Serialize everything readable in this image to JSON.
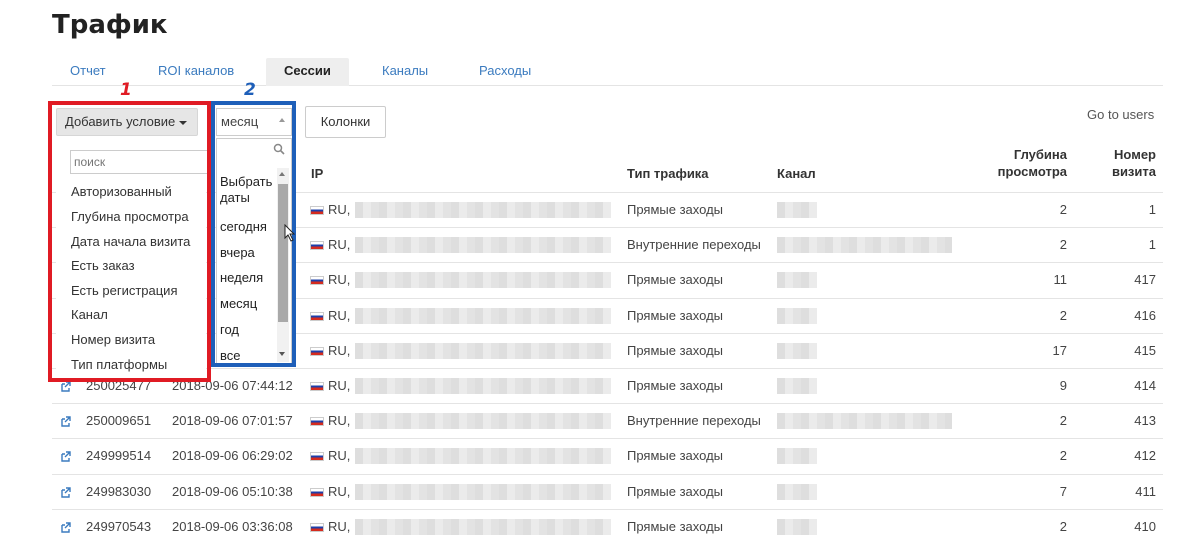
{
  "page": {
    "title": "Трафик"
  },
  "tabs": [
    {
      "label": "Отчет",
      "active": false
    },
    {
      "label": "ROI каналов",
      "active": false
    },
    {
      "label": "Сессии",
      "active": true
    },
    {
      "label": "Каналы",
      "active": false
    },
    {
      "label": "Расходы",
      "active": false
    }
  ],
  "toolbar": {
    "add_condition_label": "Добавить условие",
    "period_value": "месяц",
    "columns_label": "Колонки",
    "go_users_label": "Go to users"
  },
  "condition_dropdown": {
    "search_placeholder": "поиск",
    "items": [
      "Авторизованный",
      "Глубина просмотра",
      "Дата начала визита",
      "Есть заказ",
      "Есть регистрация",
      "Канал",
      "Номер визита",
      "Тип платформы"
    ]
  },
  "period_dropdown": {
    "options": [
      "Выбрать даты",
      "сегодня",
      "вчера",
      "неделя",
      "месяц",
      "год",
      "все"
    ]
  },
  "annotations": {
    "label1": "1",
    "label2": "2",
    "color1": "#e01b24",
    "color2": "#1e5fb9"
  },
  "table": {
    "headers": {
      "ip": "IP",
      "traffic_type": "Тип трафика",
      "channel": "Канал",
      "depth": "Глубина просмотра",
      "visit_number": "Номер визита"
    },
    "rows": [
      {
        "id": "",
        "datetime": "",
        "ip": "RU, I",
        "traffic_type": "Прямые заходы",
        "depth": "2",
        "visit_number": "1"
      },
      {
        "id": "",
        "datetime": "",
        "ip": "RU, I",
        "traffic_type": "Внутренние переходы",
        "depth": "2",
        "visit_number": "1"
      },
      {
        "id": "",
        "datetime": "",
        "ip": "RU, I",
        "traffic_type": "Прямые заходы",
        "depth": "11",
        "visit_number": "417"
      },
      {
        "id": "",
        "datetime": "",
        "ip": "RU, I",
        "traffic_type": "Прямые заходы",
        "depth": "2",
        "visit_number": "416"
      },
      {
        "id": "",
        "datetime": "",
        "ip": "RU, I",
        "traffic_type": "Прямые заходы",
        "depth": "17",
        "visit_number": "415"
      },
      {
        "id": "250025477",
        "datetime": "2018-09-06 07:44:12",
        "ip": "RU, I",
        "traffic_type": "Прямые заходы",
        "depth": "9",
        "visit_number": "414"
      },
      {
        "id": "250009651",
        "datetime": "2018-09-06 07:01:57",
        "ip": "RU, I",
        "traffic_type": "Внутренние переходы",
        "depth": "2",
        "visit_number": "413"
      },
      {
        "id": "249999514",
        "datetime": "2018-09-06 06:29:02",
        "ip": "RU, I",
        "traffic_type": "Прямые заходы",
        "depth": "2",
        "visit_number": "412"
      },
      {
        "id": "249983030",
        "datetime": "2018-09-06 05:10:38",
        "ip": "RU, I",
        "traffic_type": "Прямые заходы",
        "depth": "7",
        "visit_number": "411"
      },
      {
        "id": "249970543",
        "datetime": "2018-09-06 03:36:08",
        "ip": "RU, I",
        "traffic_type": "Прямые заходы",
        "depth": "2",
        "visit_number": "410"
      }
    ]
  }
}
